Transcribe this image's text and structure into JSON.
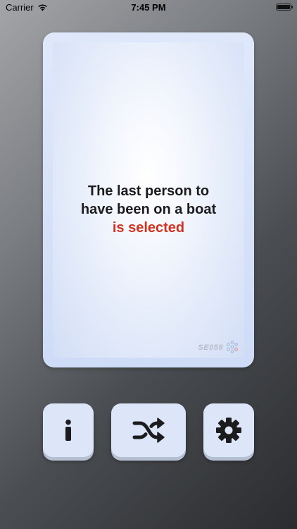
{
  "status_bar": {
    "carrier": "Carrier",
    "time": "7:45 PM",
    "battery_level": 1.0,
    "wifi_icon": "wifi-icon",
    "battery_icon": "battery-icon"
  },
  "card": {
    "prompt_line_1": "The last person to",
    "prompt_line_2": "have been on a boat",
    "prompt_highlight": "is selected",
    "code": "SE059",
    "code_icon": "dots-cluster-icon",
    "highlight_color": "#d0321f"
  },
  "controls": {
    "info_icon": "info-icon",
    "shuffle_icon": "shuffle-icon",
    "settings_icon": "gear-icon"
  },
  "colors": {
    "card_background": "#dfe8fb",
    "button_background": "#dde6f8",
    "icon_color": "#1c1c1e"
  }
}
